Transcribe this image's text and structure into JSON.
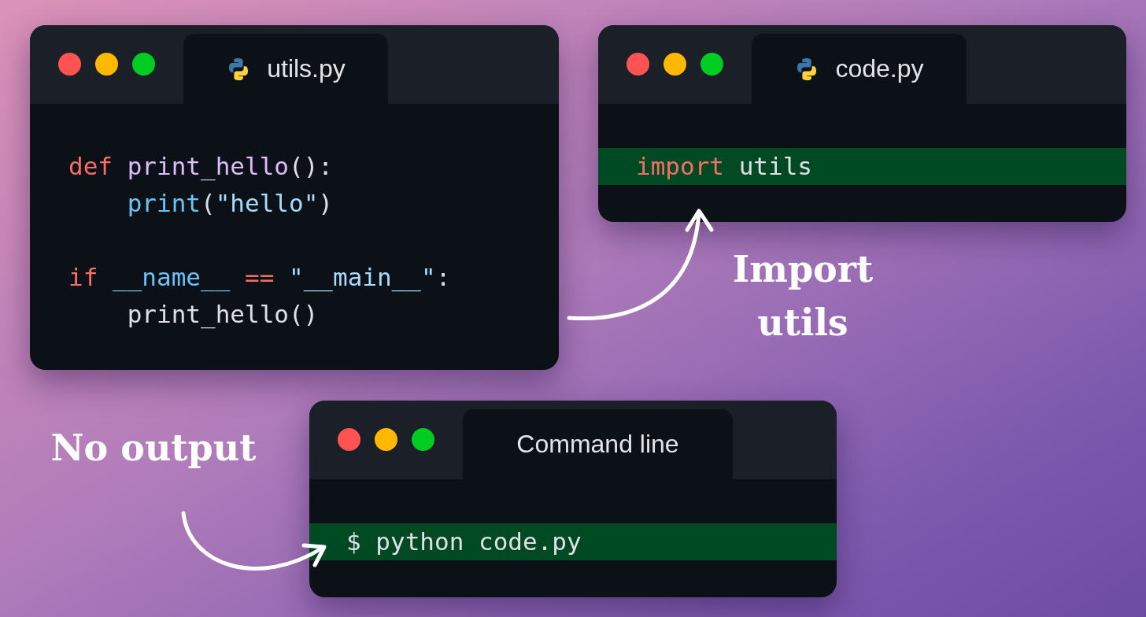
{
  "windows": [
    {
      "kind": "file",
      "title": "utils.py",
      "lines": [
        {
          "highlighted": false,
          "tokens": [
            {
              "text": "def ",
              "kind": "keyword"
            },
            {
              "text": "print_hello",
              "kind": "function"
            },
            {
              "text": "():",
              "kind": "plain"
            }
          ]
        },
        {
          "highlighted": false,
          "tokens": [
            {
              "text": "    print",
              "kind": "builtin"
            },
            {
              "text": "(",
              "kind": "plain"
            },
            {
              "text": "\"hello\"",
              "kind": "string"
            },
            {
              "text": ")",
              "kind": "plain"
            }
          ]
        },
        {
          "highlighted": false,
          "blank_line_before": true,
          "tokens": [
            {
              "text": "if ",
              "kind": "keyword"
            },
            {
              "text": "__name__ ",
              "kind": "builtin"
            },
            {
              "text": "== ",
              "kind": "keyword"
            },
            {
              "text": "\"__main__\"",
              "kind": "string"
            },
            {
              "text": ":",
              "kind": "plain"
            }
          ]
        },
        {
          "highlighted": false,
          "tokens": [
            {
              "text": "    print_hello()",
              "kind": "plain"
            }
          ]
        }
      ]
    },
    {
      "kind": "file",
      "title": "code.py",
      "lines": [
        {
          "highlighted": true,
          "tokens": [
            {
              "text": "import ",
              "kind": "keyword"
            },
            {
              "text": "utils",
              "kind": "plain"
            }
          ]
        }
      ]
    },
    {
      "kind": "terminal",
      "title": "Command line",
      "lines": [
        {
          "highlighted": true,
          "tokens": [
            {
              "text": "$ python code.py",
              "kind": "plain"
            }
          ]
        }
      ]
    }
  ],
  "annotations": [
    {
      "text": "Import utils"
    },
    {
      "text": "No output"
    }
  ]
}
